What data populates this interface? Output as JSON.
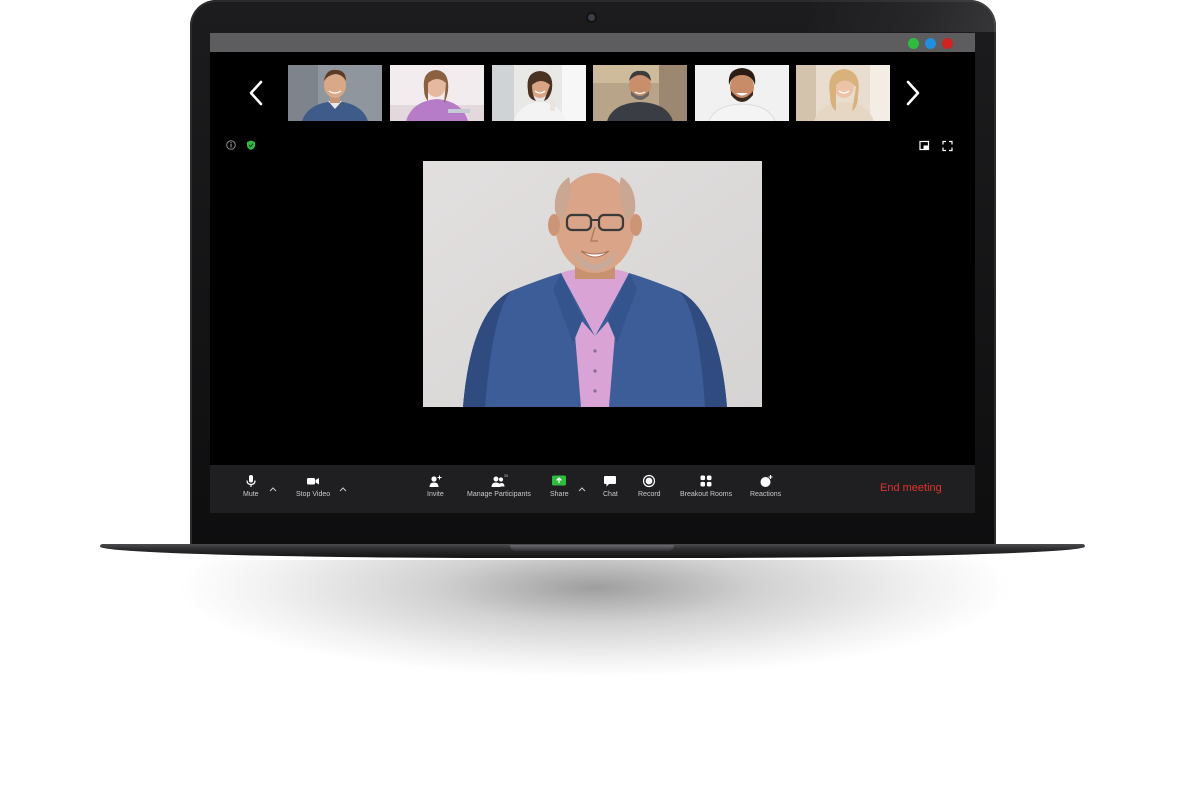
{
  "window": {
    "controls": [
      "green",
      "blue",
      "red"
    ],
    "colors": {
      "green": "#2dbd3e",
      "blue": "#1f8fe0",
      "red": "#d32222"
    }
  },
  "participants_strip": {
    "prev_icon": "chevron-left-icon",
    "next_icon": "chevron-right-icon",
    "thumbnails": [
      {
        "name": "participant-1",
        "shirt": "#3f5b8a",
        "skin": "#d9a987",
        "hair": "#5b3b24",
        "bg": "#9aa0a6"
      },
      {
        "name": "participant-2",
        "shirt": "#b77cc7",
        "skin": "#e6b8a0",
        "hair": "#8a6241",
        "bg": "#f2ecee"
      },
      {
        "name": "participant-3",
        "shirt": "#f3f3f3",
        "skin": "#d9a484",
        "hair": "#4b3323",
        "bg": "#e8e8e6"
      },
      {
        "name": "participant-4",
        "shirt": "#3a3e44",
        "skin": "#c98f6c",
        "hair": "#3c3c3c",
        "bg": "#b8a489"
      },
      {
        "name": "participant-5",
        "shirt": "#f4f4f4",
        "skin": "#c88c68",
        "hair": "#2b1d14",
        "bg": "#f1f1f1"
      },
      {
        "name": "participant-6",
        "shirt": "#e6d7c5",
        "skin": "#ecc3a6",
        "hair": "#d8b27a",
        "bg": "#e8ddcf"
      }
    ]
  },
  "main_video": {
    "speaker": {
      "suit": "#3d5d98",
      "shirt": "#d9a3d6",
      "skin": "#d9a487",
      "hair": "#c9a793",
      "bg": "#dddada"
    }
  },
  "toolbar": {
    "left": [
      {
        "id": "mute",
        "label": "Mute",
        "icon": "microphone-icon",
        "has_caret": true
      },
      {
        "id": "stop-video",
        "label": "Stop Video",
        "icon": "video-camera-icon",
        "has_caret": true
      }
    ],
    "center": [
      {
        "id": "invite",
        "label": "Invite",
        "icon": "add-user-icon"
      },
      {
        "id": "manage-participants",
        "label": "Manage Participants",
        "icon": "participants-icon",
        "badge": "39"
      },
      {
        "id": "share",
        "label": "Share",
        "icon": "share-screen-icon",
        "accent": "#2dbd3e",
        "has_caret": true
      },
      {
        "id": "chat",
        "label": "Chat",
        "icon": "chat-bubble-icon"
      },
      {
        "id": "record",
        "label": "Record",
        "icon": "record-icon"
      },
      {
        "id": "breakout-rooms",
        "label": "Breakout Rooms",
        "icon": "breakout-rooms-icon"
      },
      {
        "id": "reactions",
        "label": "Reactions",
        "icon": "add-reaction-icon"
      }
    ],
    "end_meeting": {
      "label": "End meeting",
      "color": "#e0332b"
    }
  }
}
